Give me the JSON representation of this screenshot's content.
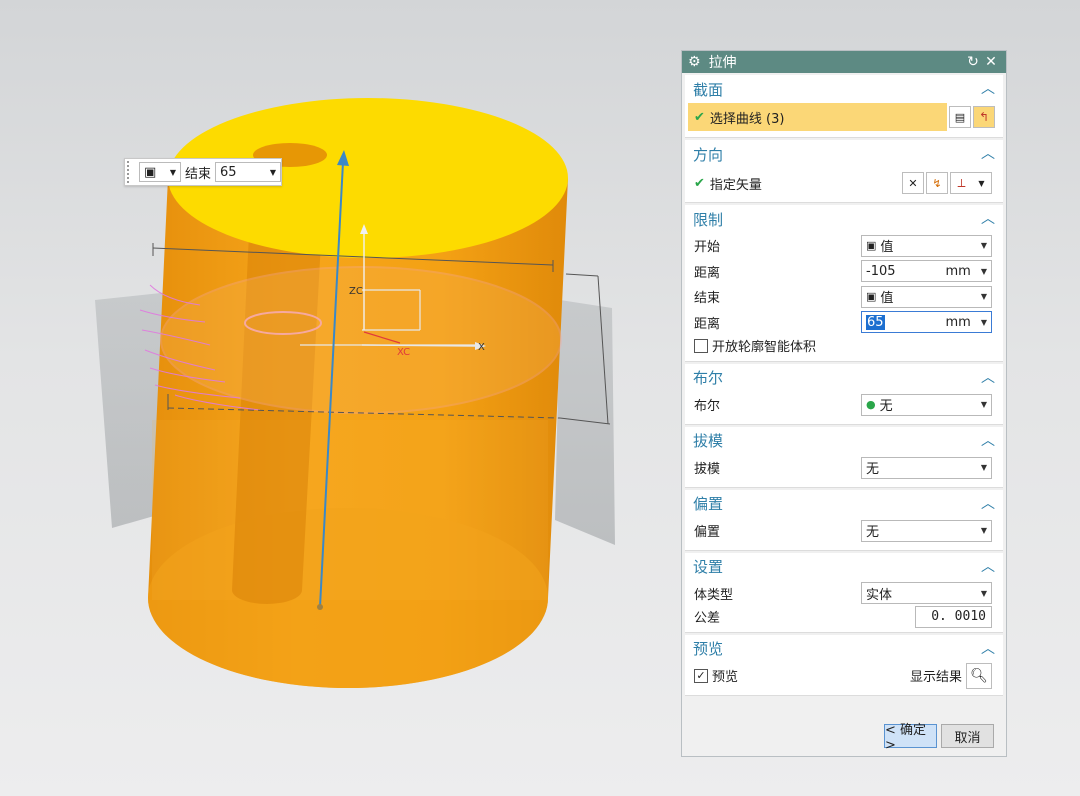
{
  "viewport": {
    "labels": {
      "zc": "ZC",
      "xc": "XC",
      "x": "X"
    }
  },
  "floatbar": {
    "end_label": "结束",
    "end_value": "65"
  },
  "dialog": {
    "title": "拉伸",
    "section": {
      "title": "截面",
      "select_curve": "选择曲线 (3)"
    },
    "direction": {
      "title": "方向",
      "specify_vector": "指定矢量"
    },
    "limits": {
      "title": "限制",
      "start_label": "开始",
      "start_value": "值",
      "start_distance_label": "距离",
      "start_distance": "-105",
      "end_label": "结束",
      "end_value": "值",
      "end_distance_label": "距离",
      "end_distance": "65",
      "unit": "mm",
      "open_profile": "开放轮廓智能体积"
    },
    "boolean": {
      "title": "布尔",
      "label": "布尔",
      "value": "无"
    },
    "draft": {
      "title": "拔模",
      "label": "拔模",
      "value": "无"
    },
    "offset": {
      "title": "偏置",
      "label": "偏置",
      "value": "无"
    },
    "settings": {
      "title": "设置",
      "body_type_label": "体类型",
      "body_type": "实体",
      "tolerance_label": "公差",
      "tolerance": "0. 0010"
    },
    "preview": {
      "title": "预览",
      "checkbox_label": "预览",
      "show_result": "显示结果"
    },
    "buttons": {
      "ok": "< 确定 >",
      "cancel": "取消"
    }
  }
}
